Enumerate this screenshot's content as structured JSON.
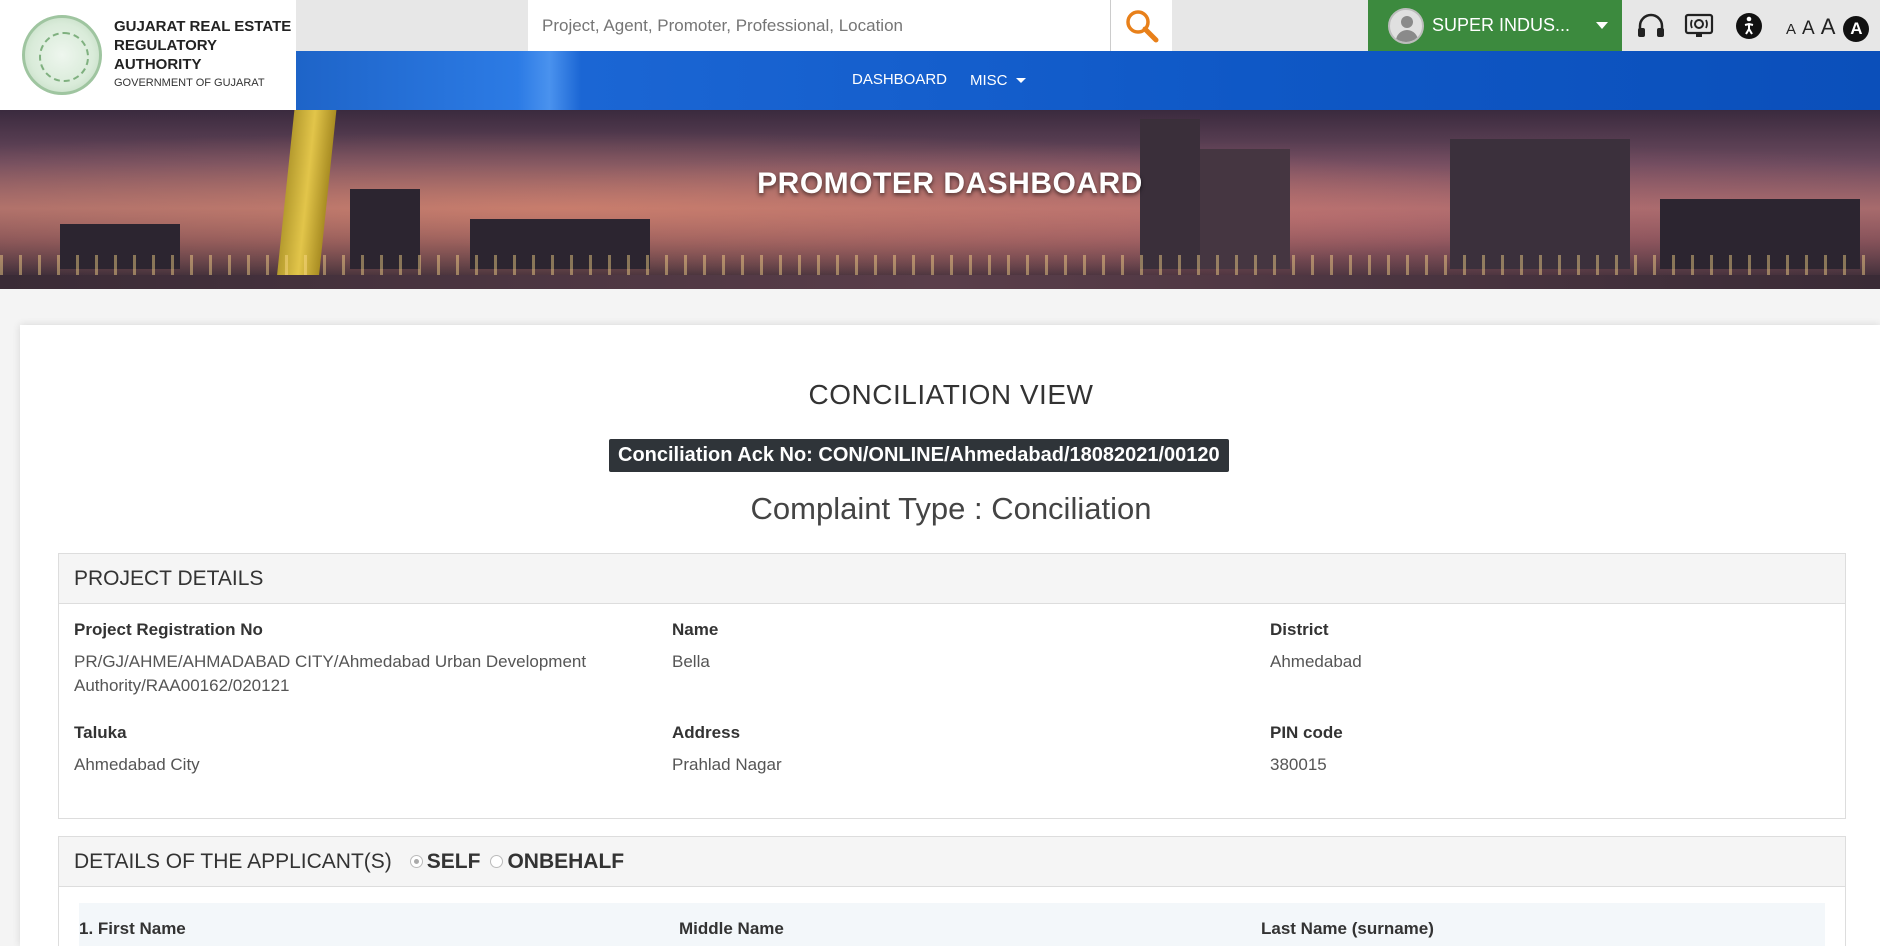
{
  "header": {
    "logo_line1": "GUJARAT REAL ESTATE",
    "logo_line2": "REGULATORY AUTHORITY",
    "logo_line3": "GOVERNMENT OF GUJARAT",
    "search_placeholder": "Project, Agent, Promoter, Professional, Location",
    "user_name": "SUPER INDUS...",
    "font_sizes": [
      "A",
      "A",
      "A"
    ],
    "contrast_label": "A"
  },
  "nav": {
    "dashboard": "DASHBOARD",
    "misc": "MISC"
  },
  "banner": {
    "title": "PROMOTER DASHBOARD"
  },
  "page": {
    "title": "CONCILIATION VIEW",
    "ack": "Conciliation Ack No: CON/ONLINE/Ahmedabad/18082021/00120",
    "complaint_type": "Complaint Type : Conciliation"
  },
  "project_details": {
    "heading": "PROJECT DETAILS",
    "fields": [
      {
        "label": "Project Registration No",
        "value": "PR/GJ/AHME/AHMADABAD CITY/Ahmedabad Urban Development Authority/RAA00162/020121"
      },
      {
        "label": "Name",
        "value": "Bella"
      },
      {
        "label": "District",
        "value": "Ahmedabad"
      },
      {
        "label": "Taluka",
        "value": "Ahmedabad City"
      },
      {
        "label": "Address",
        "value": "Prahlad Nagar"
      },
      {
        "label": "PIN code",
        "value": "380015"
      }
    ]
  },
  "applicant": {
    "heading": "DETAILS OF THE APPLICANT(S)",
    "options": [
      "SELF",
      "ONBEHALF"
    ],
    "selected": "SELF",
    "columns": [
      "1. First Name",
      "Middle Name",
      "Last Name (surname)"
    ]
  },
  "colors": {
    "nav_blue": "#0f58c6",
    "user_green": "#3c8a3e",
    "badge_dark": "#2f3439"
  }
}
